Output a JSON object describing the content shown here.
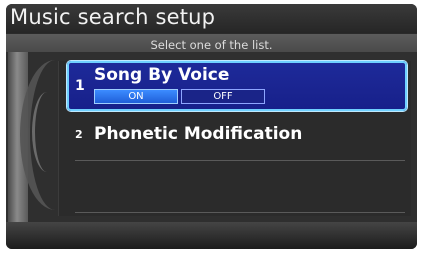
{
  "header": {
    "title": "Music search setup",
    "instruction": "Select one of the list."
  },
  "list": {
    "items": [
      {
        "number": "1",
        "label": "Song By Voice",
        "selected": true,
        "options": [
          {
            "label": "ON",
            "active": true
          },
          {
            "label": "OFF",
            "active": false
          }
        ]
      },
      {
        "number": "2",
        "label": "Phonetic Modification",
        "selected": false
      }
    ]
  },
  "colors": {
    "selection_fill": "#1e2a9a",
    "selection_border": "#6fd0ff",
    "toggle_active": "#3c8cff",
    "background": "#2f2f2f"
  }
}
